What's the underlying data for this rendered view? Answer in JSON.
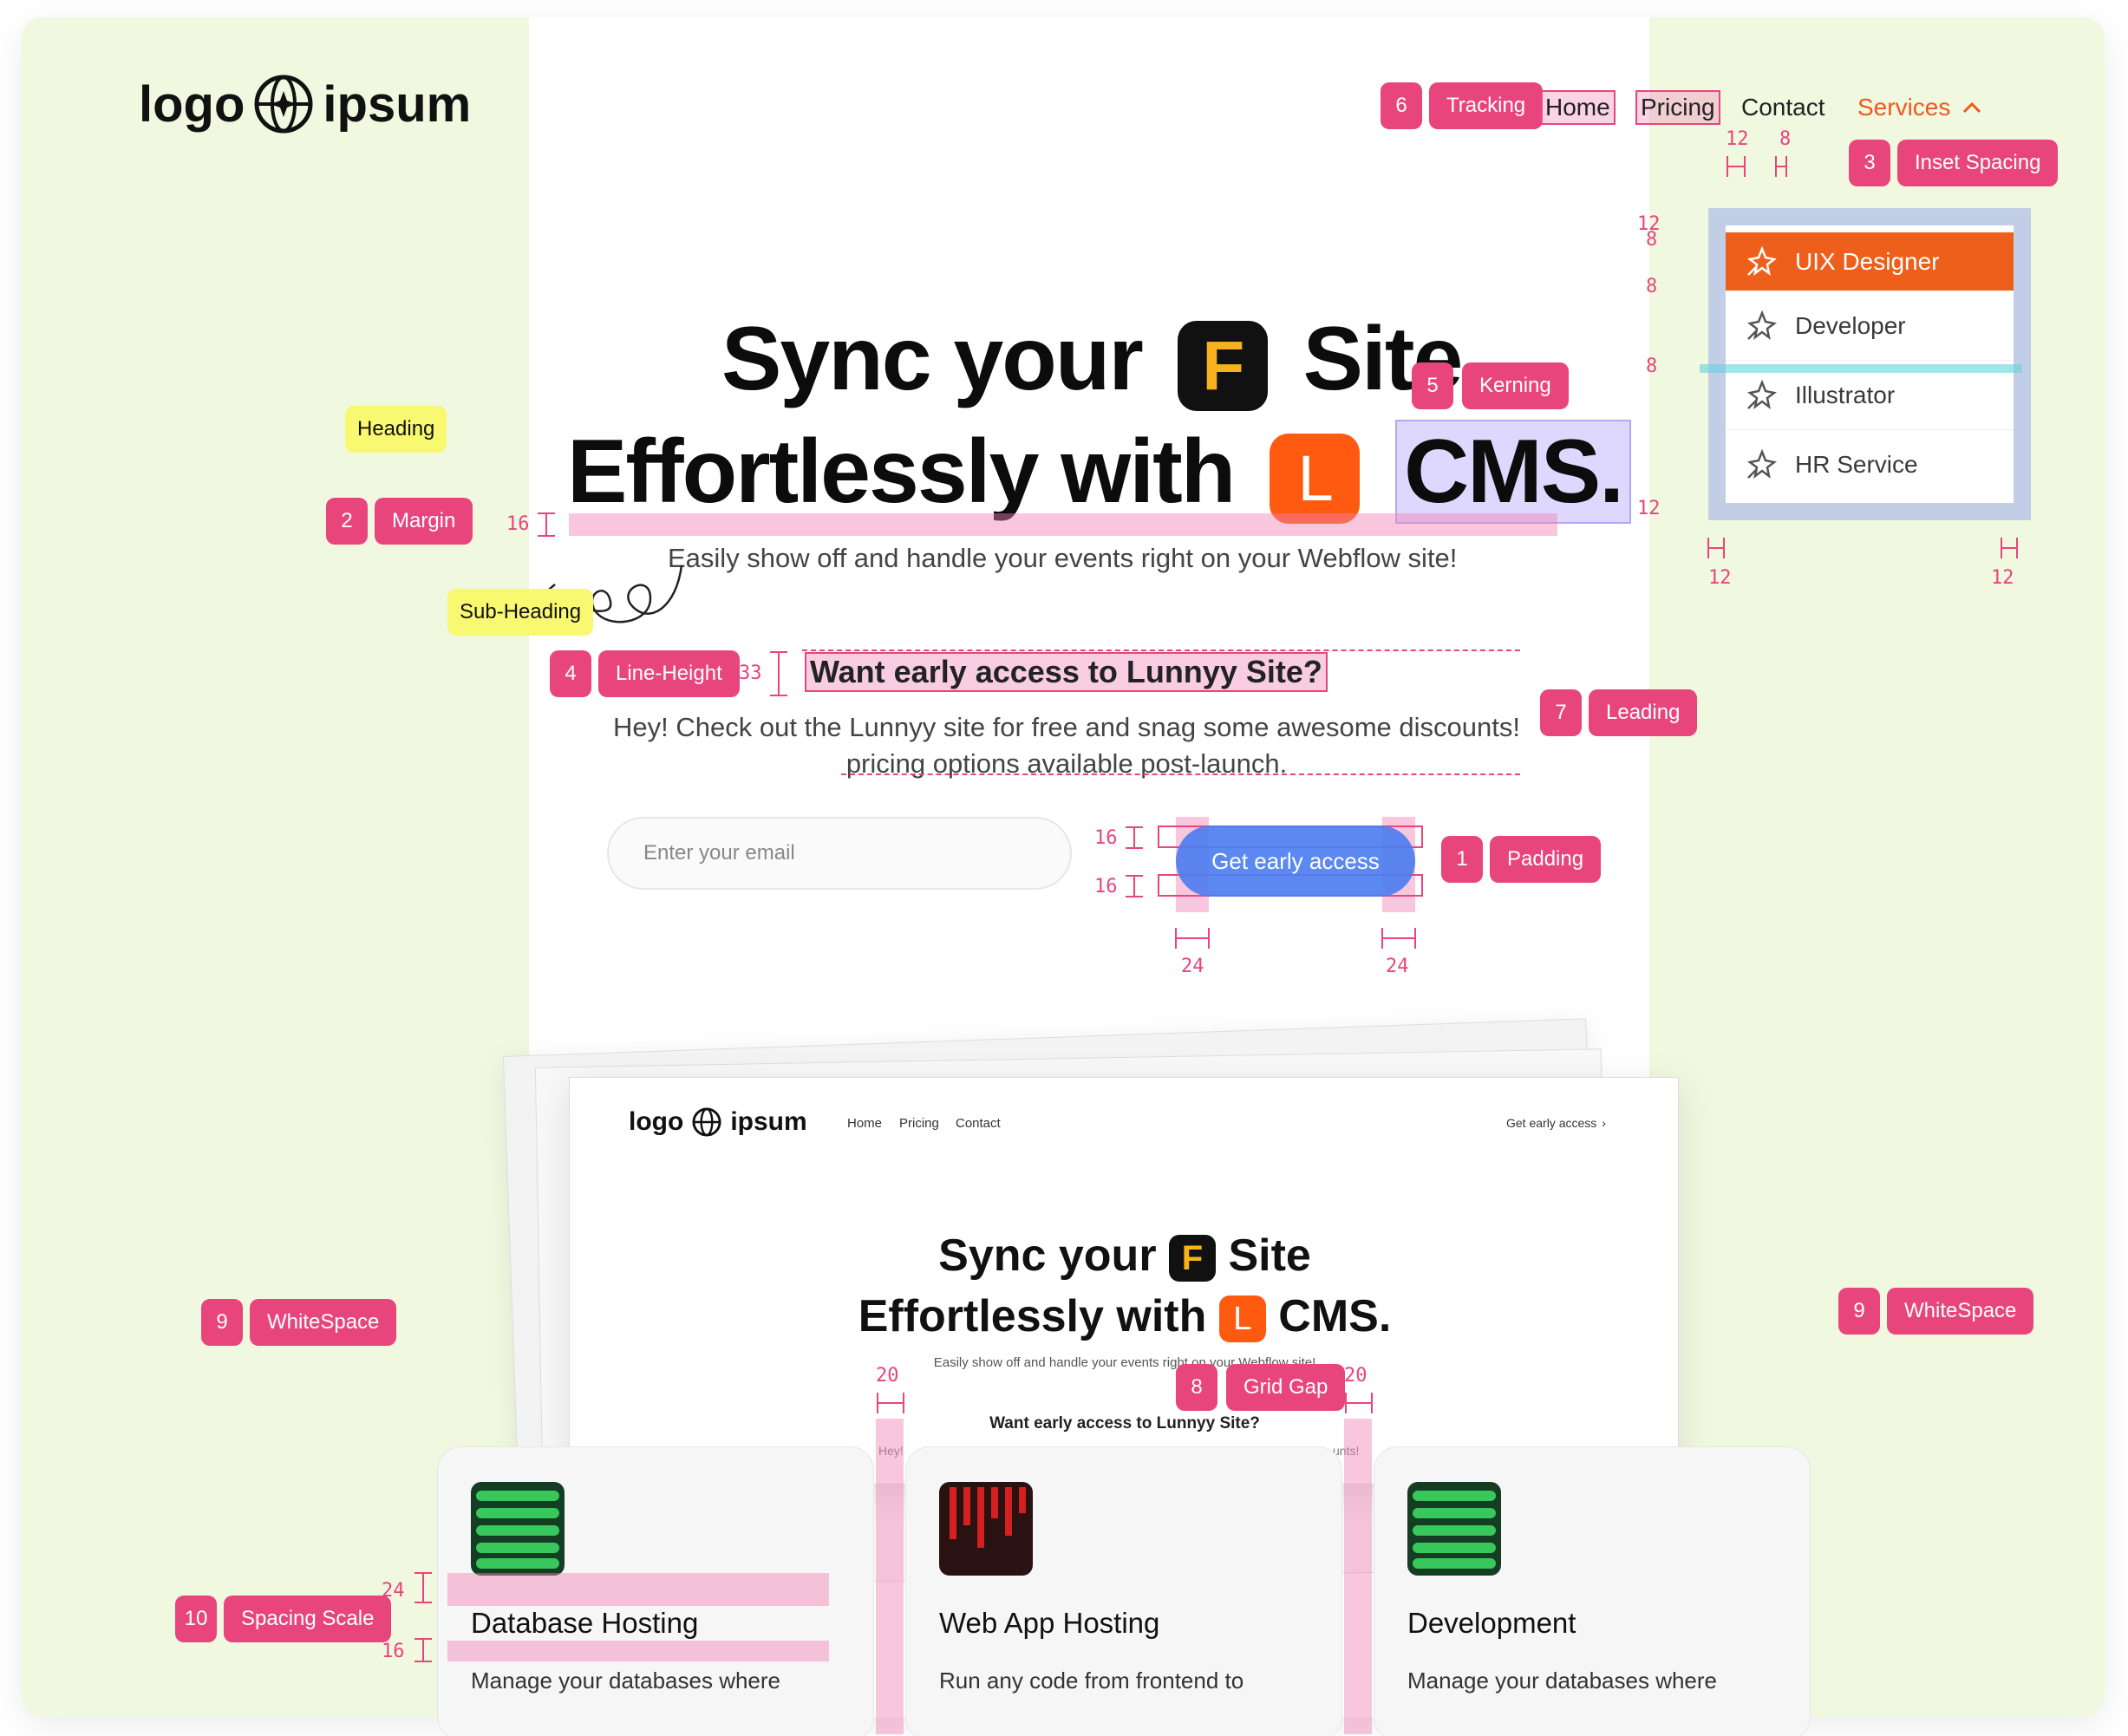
{
  "logo": {
    "left": "logo",
    "right": "ipsum"
  },
  "nav": {
    "home": "Home",
    "pricing": "Pricing",
    "contact": "Contact",
    "services": "Services"
  },
  "hero": {
    "line1_a": "Sync your",
    "icon1": "F",
    "line1_b": "Site",
    "line2_a": "Effortlessly with",
    "icon2": "L",
    "line2_b": "CMS.",
    "subheading": "Easily show off and handle your events right on your Webflow site!"
  },
  "access": {
    "title": "Want early access to Lunnyy Site?",
    "body_line1": "Hey! Check out the Lunnyy site for free and snag some awesome discounts!",
    "body_line2": "pricing options available post-launch.",
    "email_placeholder": "Enter your email",
    "cta": "Get early access"
  },
  "dropdown": [
    {
      "label": "UIX Designer"
    },
    {
      "label": "Developer"
    },
    {
      "label": "Illustrator"
    },
    {
      "label": "HR Service"
    }
  ],
  "annotations": {
    "tracking": {
      "num": "6",
      "label": "Tracking"
    },
    "inset": {
      "num": "3",
      "label": "Inset Spacing"
    },
    "kerning": {
      "num": "5",
      "label": "Kerning"
    },
    "heading": "Heading",
    "margin": {
      "num": "2",
      "label": "Margin"
    },
    "subheading": "Sub-Heading",
    "lineheight": {
      "num": "4",
      "label": "Line-Height"
    },
    "leading": {
      "num": "7",
      "label": "Leading"
    },
    "padding": {
      "num": "1",
      "label": "Padding"
    },
    "whitespace_l": {
      "num": "9",
      "label": "WhiteSpace"
    },
    "whitespace_r": {
      "num": "9",
      "label": "WhiteSpace"
    },
    "gridgap": {
      "num": "8",
      "label": "Grid Gap"
    },
    "spacing": {
      "num": "10",
      "label": "Spacing Scale"
    }
  },
  "measures": {
    "m12a": "12",
    "m8a": "8",
    "r12": "12",
    "r8a": "8",
    "r8b": "8",
    "r8c": "8",
    "r12b": "12",
    "b12l": "12",
    "b12r": "12",
    "margin16": "16",
    "lh33": "33",
    "pad16t": "16",
    "pad16b": "16",
    "pad24l": "24",
    "pad24r": "24",
    "gap20l": "20",
    "gap20r": "20",
    "sp24": "24",
    "sp16": "16"
  },
  "preview": {
    "nav_home": "Home",
    "nav_pricing": "Pricing",
    "nav_contact": "Contact",
    "cta": "Get early access",
    "line1_a": "Sync your",
    "line1_b": "Site",
    "line2_a": "Effortlessly with",
    "line2_b": "CMS.",
    "sub": "Easily show off and handle your events right on your Webflow site!",
    "access": "Want early access to Lunnyy Site?",
    "hey": "Hey!",
    "unts": "unts!"
  },
  "cards": [
    {
      "title": "Database Hosting",
      "text": "Manage your databases where"
    },
    {
      "title": "Web App Hosting",
      "text": "Run any code from frontend to"
    },
    {
      "title": "Development",
      "text": "Manage your databases where"
    }
  ],
  "colors": {
    "background": "#f0f8e0",
    "accent_pink": "#e8457c",
    "services_orange": "#ee5a1c",
    "cta_blue": "#4e7ef0",
    "icon_f_bg": "#111111",
    "icon_f_fg": "#f7b21b",
    "icon_l_bg": "#ff5a10"
  }
}
